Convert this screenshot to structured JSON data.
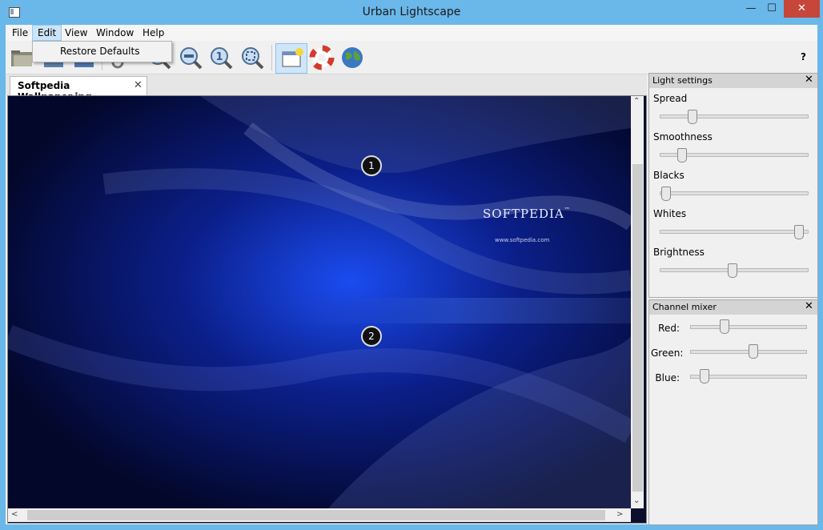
{
  "window": {
    "title": "Urban Lightscape"
  },
  "menu": {
    "items": [
      "File",
      "Edit",
      "View",
      "Window",
      "Help"
    ],
    "dropdown": {
      "item": "Restore Defaults"
    }
  },
  "toolbar": {
    "help_label": "?"
  },
  "document": {
    "tab_label": "Softpedia Wallpaper.jpg",
    "close": "✕",
    "image_text": "SOFTPEDIA",
    "image_tm": "™",
    "image_url": "www.softpedia.com",
    "markers": [
      "1",
      "2"
    ]
  },
  "light_settings": {
    "title": "Light settings",
    "sliders": [
      {
        "label": "Spread",
        "value": 0.22
      },
      {
        "label": "Smoothness",
        "value": 0.15
      },
      {
        "label": "Blacks",
        "value": 0.04
      },
      {
        "label": "Whites",
        "value": 0.96
      },
      {
        "label": "Brightness",
        "value": 0.5
      }
    ]
  },
  "channel_mixer": {
    "title": "Channel mixer",
    "sliders": [
      {
        "label": "Red:",
        "value": 0.3
      },
      {
        "label": "Green:",
        "value": 0.56
      },
      {
        "label": "Blue:",
        "value": 0.12
      }
    ]
  },
  "colors": {
    "frame": "#6ab7ea",
    "close": "#c7463a",
    "accent": "#cce4f7"
  }
}
